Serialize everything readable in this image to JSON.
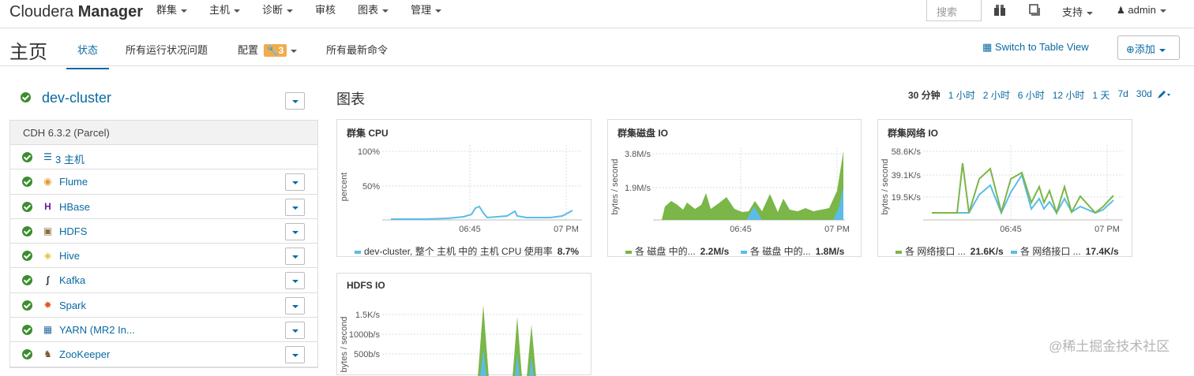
{
  "topnav": {
    "brand_light": "Cloudera",
    "brand_bold": "Manager",
    "menu": [
      "群集",
      "主机",
      "诊断",
      "审核",
      "图表",
      "管理"
    ],
    "search_placeholder": "搜索",
    "support": "支持",
    "admin": "admin"
  },
  "subhead": {
    "title": "主页",
    "tabs": [
      "状态",
      "所有运行状况问题",
      "配置",
      "所有最新命令"
    ],
    "config_badge": "3",
    "switch_view": "Switch to Table View",
    "add": "添加"
  },
  "cluster": {
    "name": "dev-cluster",
    "parcel": "CDH 6.3.2 (Parcel)",
    "hosts": "3 主机",
    "services": [
      {
        "name": "Flume",
        "icon": "flume-icon"
      },
      {
        "name": "HBase",
        "icon": "hbase-icon"
      },
      {
        "name": "HDFS",
        "icon": "hdfs-icon"
      },
      {
        "name": "Hive",
        "icon": "hive-icon"
      },
      {
        "name": "Kafka",
        "icon": "kafka-icon"
      },
      {
        "name": "Spark",
        "icon": "spark-icon"
      },
      {
        "name": "YARN (MR2 In...",
        "icon": "yarn-icon"
      },
      {
        "name": "ZooKeeper",
        "icon": "zookeeper-icon"
      }
    ]
  },
  "charts": {
    "title": "图表",
    "ranges": [
      "30 分钟",
      "1 小时",
      "2 小时",
      "6 小时",
      "12 小时",
      "1 天",
      "7d",
      "30d"
    ],
    "active_range": "30 分钟",
    "colors": {
      "green": "#7ab648",
      "blue": "#5bbde6"
    },
    "cards": [
      {
        "title": "群集 CPU",
        "ylabel": "percent",
        "yticks": [
          "100%",
          "50%"
        ],
        "xticks": [
          "06:45",
          "07 PM"
        ],
        "legend": [
          {
            "label": "dev-cluster, 整个 主机 中的 主机 CPU 使用率",
            "value": "8.7%",
            "color": "#5bbde6"
          }
        ]
      },
      {
        "title": "群集磁盘 IO",
        "ylabel": "bytes / second",
        "yticks": [
          "3.8M/s",
          "1.9M/s"
        ],
        "xticks": [
          "06:45",
          "07 PM"
        ],
        "legend": [
          {
            "label": "各 磁盘 中的...",
            "value": "2.2M/s",
            "color": "#7ab648"
          },
          {
            "label": "各 磁盘 中的...",
            "value": "1.8M/s",
            "color": "#5bbde6"
          }
        ]
      },
      {
        "title": "群集网络 IO",
        "ylabel": "bytes / second",
        "yticks": [
          "58.6K/s",
          "39.1K/s",
          "19.5K/s"
        ],
        "xticks": [
          "06:45",
          "07 PM"
        ],
        "legend": [
          {
            "label": "各 网络接口 ...",
            "value": "21.6K/s",
            "color": "#7ab648"
          },
          {
            "label": "各 网络接口 ...",
            "value": "17.4K/s",
            "color": "#5bbde6"
          }
        ]
      },
      {
        "title": "HDFS IO",
        "ylabel": "bytes / second",
        "yticks": [
          "1.5K/s",
          "1000b/s",
          "500b/s"
        ],
        "xticks": [],
        "legend": []
      }
    ]
  },
  "watermark": "@稀土掘金技术社区"
}
